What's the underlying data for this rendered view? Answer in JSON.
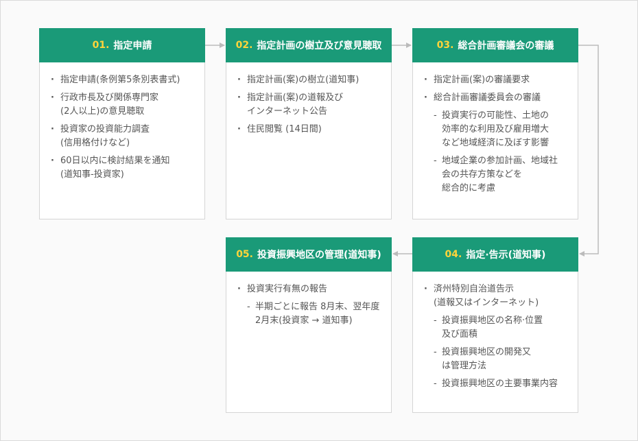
{
  "steps": [
    {
      "number": "01.",
      "title": "指定申請",
      "items": [
        {
          "text": "指定申請(条例第5条別表書式)",
          "subs": []
        },
        {
          "text": "行政市長及び関係専門家\n(2人以上)の意見聴取",
          "subs": []
        },
        {
          "text": "投資家の投資能力調査\n(信用格付けなど)",
          "subs": []
        },
        {
          "text": "60日以内に検討結果を通知\n(道知事-投資家)",
          "subs": []
        }
      ]
    },
    {
      "number": "02.",
      "title": "指定計画の樹立及び意見聴取",
      "items": [
        {
          "text": "指定計画(案)の樹立(道知事)",
          "subs": []
        },
        {
          "text": "指定計画(案)の道報及び\nインターネット公告",
          "subs": []
        },
        {
          "text": "住民閲覧 (14日間)",
          "subs": []
        }
      ]
    },
    {
      "number": "03.",
      "title": "総合計画審議会の審議",
      "items": [
        {
          "text": "指定計画(案)の審議要求",
          "subs": []
        },
        {
          "text": "総合計画審議委員会の審議",
          "subs": [
            "投資実行の可能性、土地の\n効率的な利用及び雇用増大\nなど地域経済に及ぼす影響",
            "地域企業の参加計画、地域社\n会の共存方策などを\n総合的に考慮"
          ]
        }
      ]
    },
    {
      "number": "04.",
      "title": "指定·告示(道知事)",
      "items": [
        {
          "text": "済州特別自治道告示\n(道報又はインターネット)",
          "subs": [
            "投資振興地区の名称·位置\n及び面積",
            "投資振興地区の開発又\nは管理方法",
            "投資振興地区の主要事業内容"
          ]
        }
      ]
    },
    {
      "number": "05.",
      "title": "投資振興地区の管理(道知事)",
      "items": [
        {
          "text": "投資実行有無の報告",
          "subs": [
            "半期ごとに報告 8月末、翌年度\n2月末(投資家 → 道知事)"
          ]
        }
      ]
    }
  ],
  "colors": {
    "header_bg": "#1a9a78",
    "number_accent": "#ffd43a",
    "body_text": "#555555",
    "connector": "#bbbbbb"
  }
}
